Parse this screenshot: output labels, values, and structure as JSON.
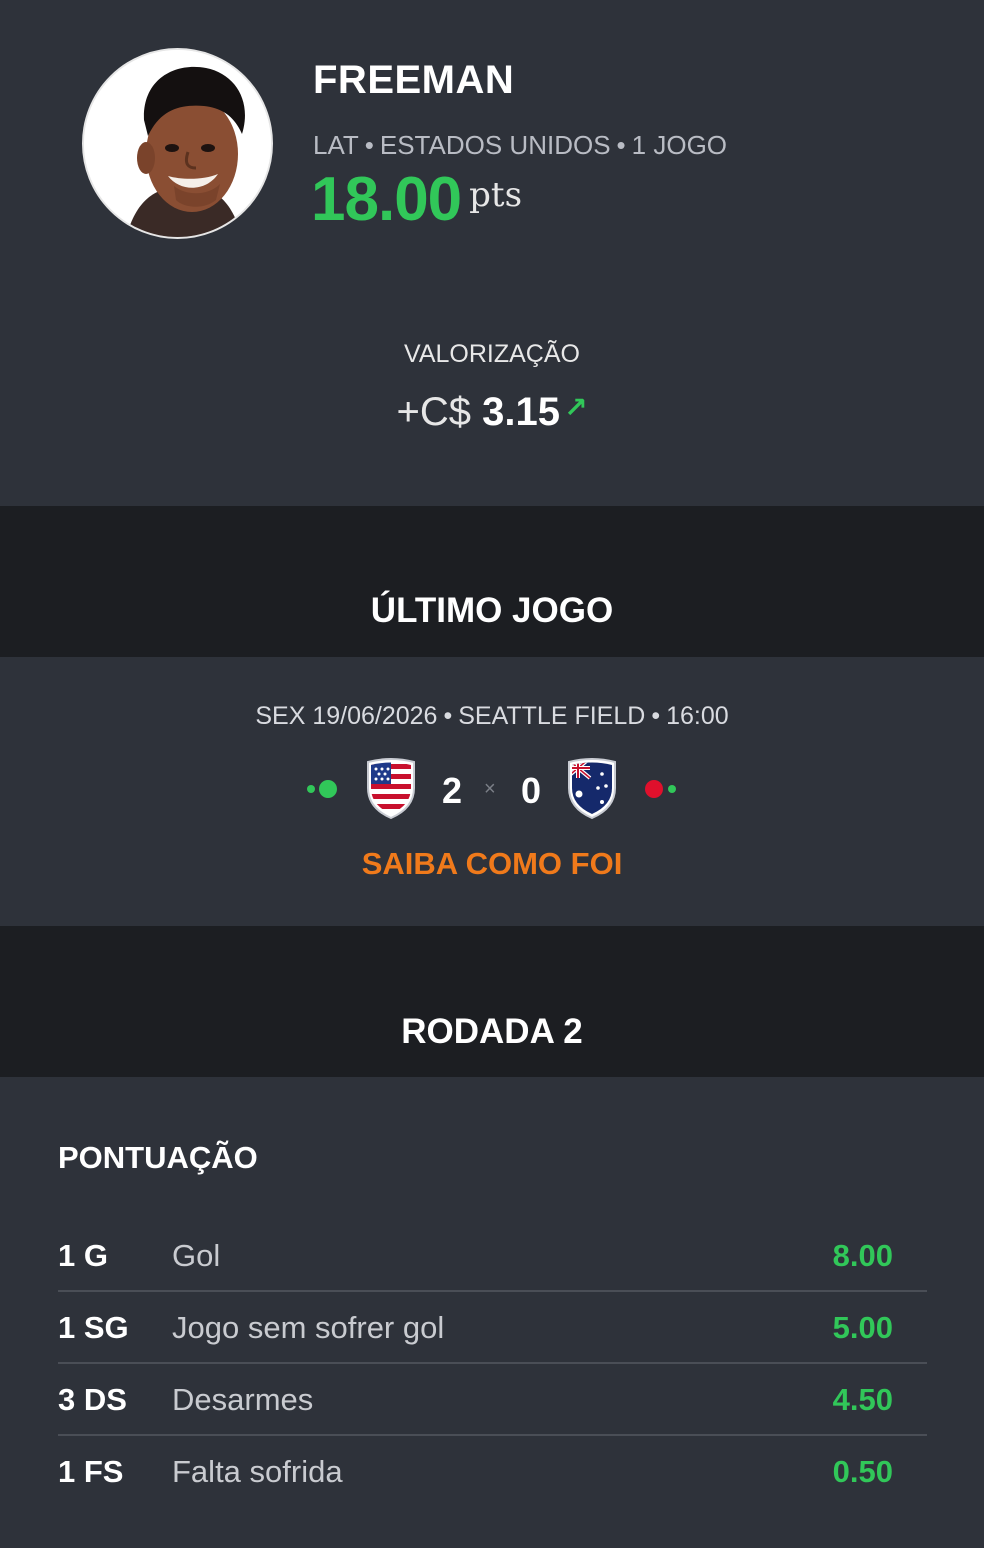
{
  "player": {
    "name": "FREEMAN",
    "position": "LAT",
    "team": "ESTADOS UNIDOS",
    "games": "1 JOGO",
    "points": "18.00",
    "points_unit": "pts"
  },
  "valorization": {
    "label": "VALORIZAÇÃO",
    "prefix": "+C$",
    "value": "3.15",
    "arrow": "↗"
  },
  "last_game": {
    "title": "ÚLTIMO JOGO",
    "day": "SEX 19/06/2026",
    "venue": "SEATTLE FIELD",
    "time": "16:00",
    "home_score": "2",
    "separator": "×",
    "away_score": "0",
    "cta": "SAIBA COMO FOI",
    "home_form": [
      "#31c759",
      "#31c759"
    ],
    "away_form": [
      "#e0102c",
      "#31c759"
    ]
  },
  "round": {
    "title": "RODADA 2"
  },
  "scoring": {
    "label": "PONTUAÇÃO",
    "rows": [
      {
        "code": "1 G",
        "desc": "Gol",
        "pts": "8.00"
      },
      {
        "code": "1 SG",
        "desc": "Jogo sem sofrer gol",
        "pts": "5.00"
      },
      {
        "code": "3 DS",
        "desc": "Desarmes",
        "pts": "4.50"
      },
      {
        "code": "1 FS",
        "desc": "Falta sofrida",
        "pts": "0.50"
      }
    ]
  },
  "colors": {
    "positive": "#31c759",
    "accent": "#f07a1b",
    "negative": "#e0102c"
  }
}
